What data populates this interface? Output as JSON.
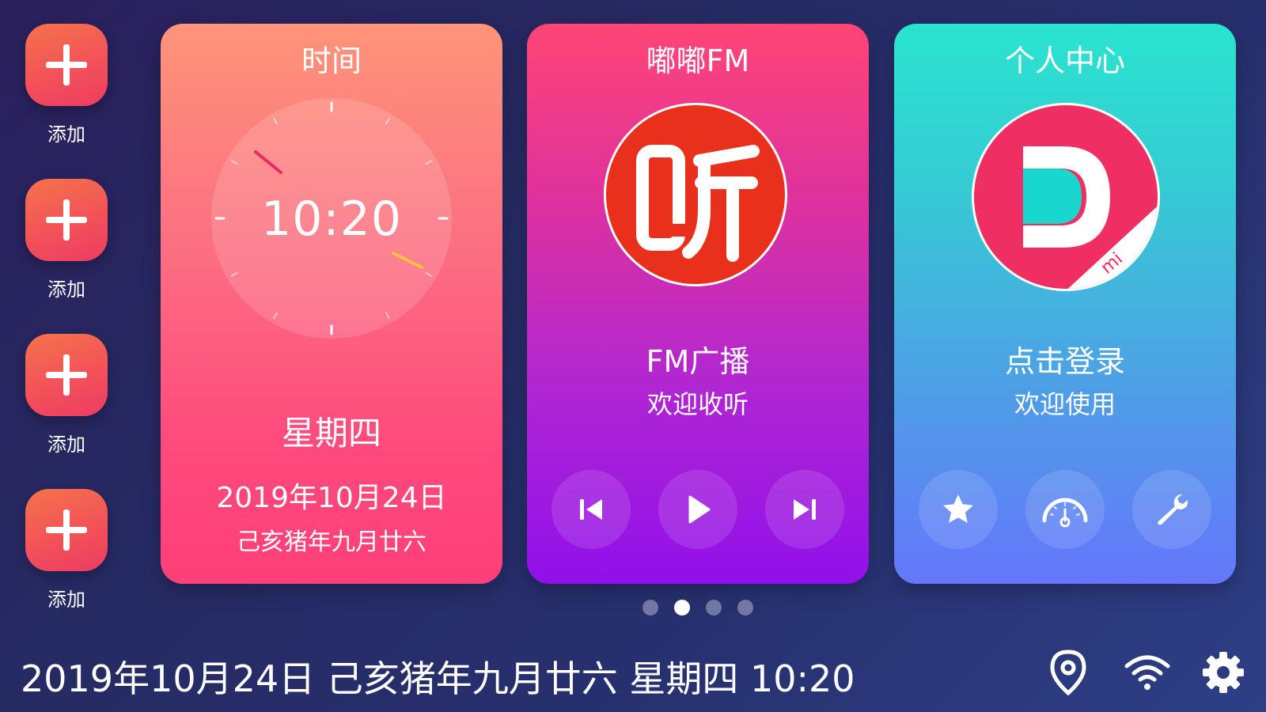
{
  "sidebar": {
    "items": [
      {
        "label": "添加"
      },
      {
        "label": "添加"
      },
      {
        "label": "添加"
      },
      {
        "label": "添加"
      }
    ]
  },
  "cards": {
    "time": {
      "title": "时间",
      "clock_time": "10:20",
      "weekday": "星期四",
      "date": "2019年10月24日",
      "lunar": "己亥猪年九月廿六"
    },
    "fm": {
      "title": "嘟嘟FM",
      "logo_icon": "ting-logo-icon",
      "line1": "FM广播",
      "line2": "欢迎收听",
      "controls": [
        "previous-icon",
        "play-icon",
        "next-icon"
      ]
    },
    "user": {
      "title": "个人中心",
      "logo_icon": "d-logo-icon",
      "line1": "点击登录",
      "line2": "欢迎使用",
      "controls": [
        "star-icon",
        "speedometer-icon",
        "wrench-icon"
      ]
    }
  },
  "pager": {
    "total": 4,
    "active": 2
  },
  "status_bar": {
    "text": "2019年10月24日 己亥猪年九月廿六 星期四 10:20",
    "icons": [
      "location-icon",
      "wifi-icon",
      "settings-icon"
    ]
  },
  "colors": {
    "add_button": "#f24f5a",
    "time_card": "#fe4a7d",
    "fm_card": "#b026d2",
    "user_card": "#4e9fe6",
    "fm_logo": "#e9301c",
    "user_logo": "#ef2e64"
  }
}
